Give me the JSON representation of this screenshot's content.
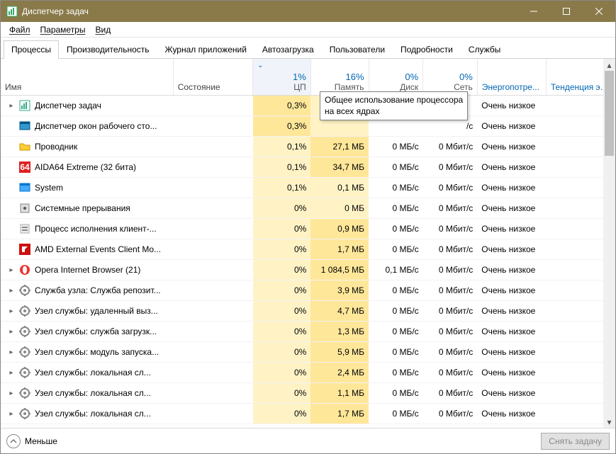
{
  "window": {
    "title": "Диспетчер задач"
  },
  "menu": {
    "file": "Файл",
    "options": "Параметры",
    "view": "Вид"
  },
  "tabs": [
    {
      "id": "processes",
      "label": "Процессы",
      "active": true
    },
    {
      "id": "performance",
      "label": "Производительность",
      "active": false
    },
    {
      "id": "apphistory",
      "label": "Журнал приложений",
      "active": false
    },
    {
      "id": "startup",
      "label": "Автозагрузка",
      "active": false
    },
    {
      "id": "users",
      "label": "Пользователи",
      "active": false
    },
    {
      "id": "details",
      "label": "Подробности",
      "active": false
    },
    {
      "id": "services",
      "label": "Службы",
      "active": false
    }
  ],
  "columns": {
    "name": "Имя",
    "status": "Состояние",
    "cpu": {
      "value": "1%",
      "label": "ЦП"
    },
    "memory": {
      "value": "16%",
      "label": "Память"
    },
    "disk": {
      "value": "0%",
      "label": "Диск"
    },
    "network": {
      "value": "0%",
      "label": "Сеть"
    },
    "power": "Энергопотре...",
    "trend": "Тенденция эн..."
  },
  "tooltip": {
    "line1": "Общее использование процессора",
    "line2": "на всех ядрах"
  },
  "rows": [
    {
      "exp": true,
      "icon": "taskmgr",
      "name": "Диспетчер задач",
      "cpu": "0,3%",
      "mem": "",
      "disk": "",
      "net": "",
      "pwr": "Очень низкое",
      "cpuD": true,
      "memD": false,
      "memVisible": false
    },
    {
      "exp": false,
      "icon": "dwm",
      "name": "Диспетчер окон рабочего сто...",
      "cpu": "0,3%",
      "mem": "",
      "disk": "",
      "net": "/с",
      "pwr": "Очень низкое",
      "cpuD": true,
      "memD": false,
      "memVisible": false
    },
    {
      "exp": false,
      "icon": "explorer",
      "name": "Проводник",
      "cpu": "0,1%",
      "mem": "27,1 МБ",
      "disk": "0 МБ/с",
      "net": "0 Мбит/с",
      "pwr": "Очень низкое",
      "cpuD": false,
      "memD": true
    },
    {
      "exp": false,
      "icon": "aida",
      "name": "AIDA64 Extreme (32 бита)",
      "cpu": "0,1%",
      "mem": "34,7 МБ",
      "disk": "0 МБ/с",
      "net": "0 Мбит/с",
      "pwr": "Очень низкое",
      "cpuD": false,
      "memD": true
    },
    {
      "exp": false,
      "icon": "system",
      "name": "System",
      "cpu": "0,1%",
      "mem": "0,1 МБ",
      "disk": "0 МБ/с",
      "net": "0 Мбит/с",
      "pwr": "Очень низкое",
      "cpuD": false,
      "memD": false
    },
    {
      "exp": false,
      "icon": "interrupt",
      "name": "Системные прерывания",
      "cpu": "0%",
      "mem": "0 МБ",
      "disk": "0 МБ/с",
      "net": "0 Мбит/с",
      "pwr": "Очень низкое",
      "cpuD": false,
      "memD": false
    },
    {
      "exp": false,
      "icon": "process",
      "name": "Процесс исполнения клиент-...",
      "cpu": "0%",
      "mem": "0,9 МБ",
      "disk": "0 МБ/с",
      "net": "0 Мбит/с",
      "pwr": "Очень низкое",
      "cpuD": false,
      "memD": true
    },
    {
      "exp": false,
      "icon": "amd",
      "name": "AMD External Events Client Mo...",
      "cpu": "0%",
      "mem": "1,7 МБ",
      "disk": "0 МБ/с",
      "net": "0 Мбит/с",
      "pwr": "Очень низкое",
      "cpuD": false,
      "memD": true
    },
    {
      "exp": true,
      "icon": "opera",
      "name": "Opera Internet Browser (21)",
      "cpu": "0%",
      "mem": "1 084,5 МБ",
      "disk": "0,1 МБ/с",
      "net": "0 Мбит/с",
      "pwr": "Очень низкое",
      "cpuD": false,
      "memD": true
    },
    {
      "exp": true,
      "icon": "svc",
      "name": "Служба узла: Служба репозит...",
      "cpu": "0%",
      "mem": "3,9 МБ",
      "disk": "0 МБ/с",
      "net": "0 Мбит/с",
      "pwr": "Очень низкое",
      "cpuD": false,
      "memD": true
    },
    {
      "exp": true,
      "icon": "svc",
      "name": "Узел службы: удаленный выз...",
      "cpu": "0%",
      "mem": "4,7 МБ",
      "disk": "0 МБ/с",
      "net": "0 Мбит/с",
      "pwr": "Очень низкое",
      "cpuD": false,
      "memD": true
    },
    {
      "exp": true,
      "icon": "svc",
      "name": "Узел службы: служба загрузк...",
      "cpu": "0%",
      "mem": "1,3 МБ",
      "disk": "0 МБ/с",
      "net": "0 Мбит/с",
      "pwr": "Очень низкое",
      "cpuD": false,
      "memD": true
    },
    {
      "exp": true,
      "icon": "svc",
      "name": "Узел службы: модуль запуска...",
      "cpu": "0%",
      "mem": "5,9 МБ",
      "disk": "0 МБ/с",
      "net": "0 Мбит/с",
      "pwr": "Очень низкое",
      "cpuD": false,
      "memD": true
    },
    {
      "exp": true,
      "icon": "svc",
      "name": "Узел службы: локальная сл...",
      "cpu": "0%",
      "mem": "2,4 МБ",
      "disk": "0 МБ/с",
      "net": "0 Мбит/с",
      "pwr": "Очень низкое",
      "cpuD": false,
      "memD": true
    },
    {
      "exp": true,
      "icon": "svc",
      "name": "Узел службы: локальная сл...",
      "cpu": "0%",
      "mem": "1,1 МБ",
      "disk": "0 МБ/с",
      "net": "0 Мбит/с",
      "pwr": "Очень низкое",
      "cpuD": false,
      "memD": true
    },
    {
      "exp": true,
      "icon": "svc",
      "name": "Узел службы: локальная сл...",
      "cpu": "0%",
      "mem": "1,7 МБ",
      "disk": "0 МБ/с",
      "net": "0 Мбит/с",
      "pwr": "Очень низкое",
      "cpuD": false,
      "memD": true
    }
  ],
  "footer": {
    "less": "Меньше",
    "endtask": "Снять задачу"
  }
}
